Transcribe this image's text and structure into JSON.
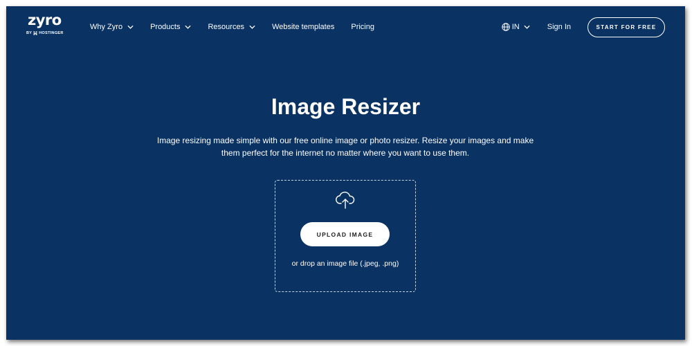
{
  "colors": {
    "background": "#0a3262",
    "text": "#ffffff",
    "button_bg": "#ffffff",
    "button_text": "#1d1e20"
  },
  "header": {
    "logo_text": "zyro",
    "logo_byline": "BY HOSTINGER",
    "nav": [
      {
        "label": "Why Zyro",
        "has_dropdown": true
      },
      {
        "label": "Products",
        "has_dropdown": true
      },
      {
        "label": "Resources",
        "has_dropdown": true
      },
      {
        "label": "Website templates",
        "has_dropdown": false
      },
      {
        "label": "Pricing",
        "has_dropdown": false
      }
    ],
    "language": {
      "icon": "globe-icon",
      "label": "IN"
    },
    "sign_in": "Sign In",
    "cta": "START FOR FREE"
  },
  "hero": {
    "title": "Image Resizer",
    "description": "Image resizing made simple with our free online image or photo resizer. Resize your images and make them perfect for the internet no matter where you want to use them."
  },
  "upload": {
    "icon": "cloud-upload-icon",
    "button_label": "UPLOAD IMAGE",
    "hint": "or drop an image file (.jpeg, .png)"
  }
}
